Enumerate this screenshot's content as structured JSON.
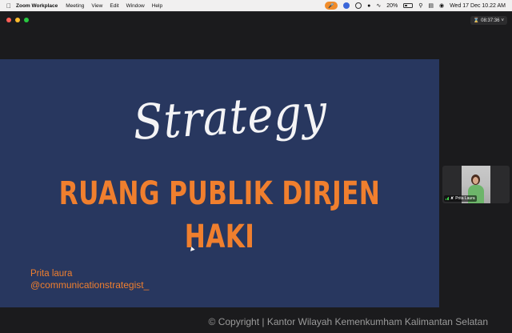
{
  "menubar": {
    "app_name": "Zoom Workplace",
    "menus": [
      "Meeting",
      "View",
      "Edit",
      "Window",
      "Help"
    ],
    "battery_percent": "20%",
    "datetime": "Wed 17 Dec  10.22 AM"
  },
  "meeting": {
    "timer": "08:37:36"
  },
  "slide": {
    "script_title": "Strategy",
    "title_line1": "RUANG PUBLIK DIRJEN",
    "title_line2": "HAKI",
    "presenter_name": "Prita laura",
    "presenter_handle": "@communicationstrategist_",
    "background_color": "#28375f",
    "accent_color": "#f07f2e"
  },
  "participant": {
    "name": "Prita Laura"
  },
  "watermark": {
    "copyright": "© Copyright | Kantor Wilayah Kemenkumham Kalimantan Selatan"
  }
}
